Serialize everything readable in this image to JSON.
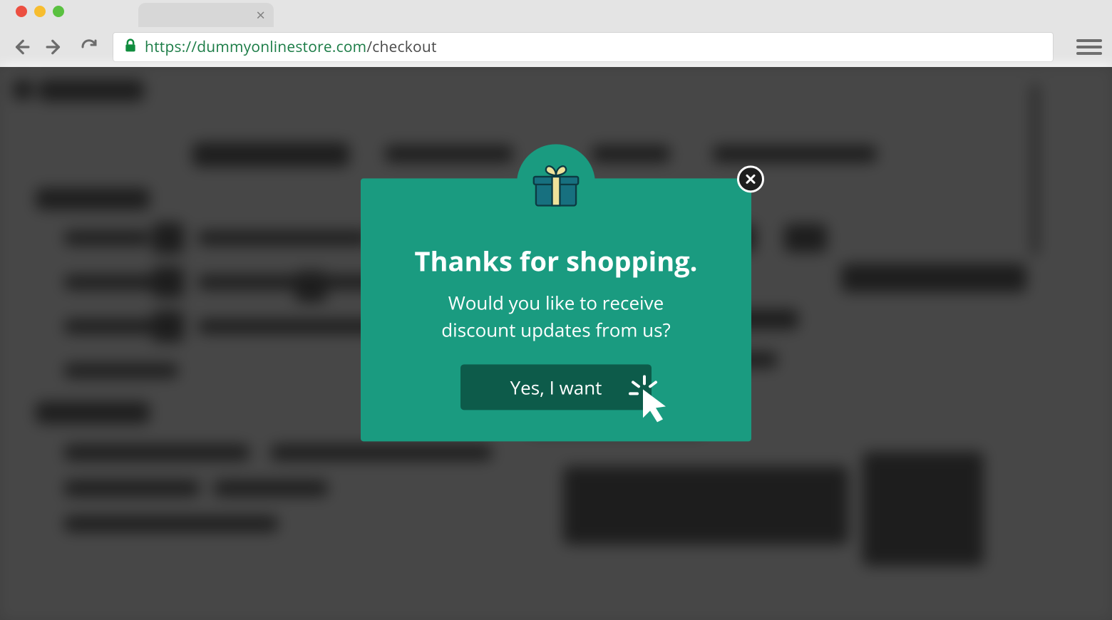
{
  "browser": {
    "url_scheme": "https://",
    "url_host": "dummyonlinestore.com",
    "url_path": "/checkout"
  },
  "modal": {
    "title": "Thanks for shopping.",
    "subtitle": "Would you like to receive discount updates from us?",
    "cta_label": "Yes, I want"
  }
}
